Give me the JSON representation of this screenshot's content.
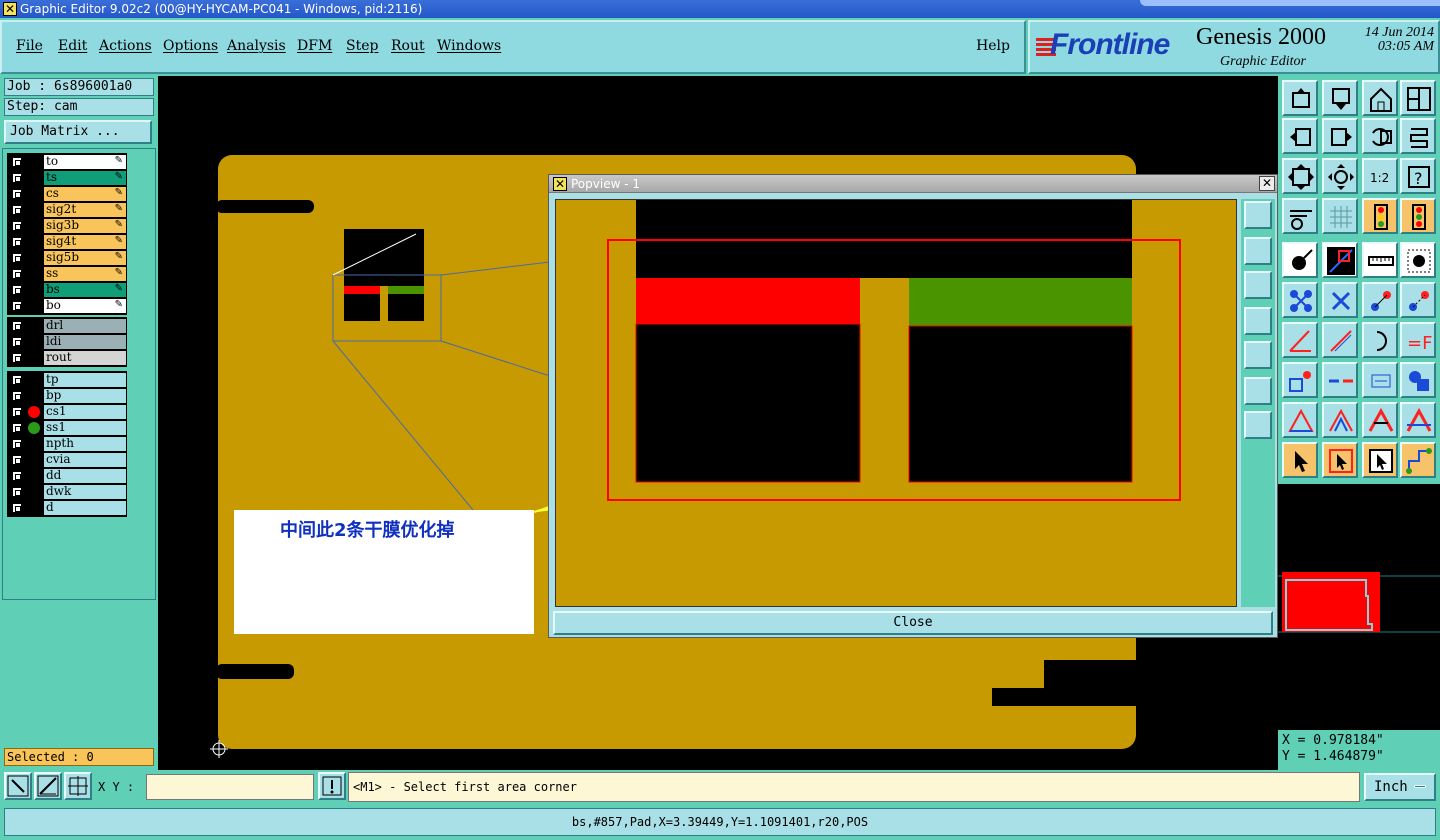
{
  "window": {
    "title": "Graphic Editor 9.02c2 (00@HY-HYCAM-PC041 - Windows, pid:2116)"
  },
  "menu": {
    "items": [
      "File",
      "Edit",
      "Actions",
      "Options",
      "Analysis",
      "DFM",
      "Step",
      "Rout",
      "Windows"
    ],
    "help": "Help"
  },
  "logo": {
    "brand": "Frontline",
    "product": "Genesis 2000",
    "subtitle": "Graphic Editor",
    "date": "14 Jun 2014",
    "time": "03:05 AM"
  },
  "job": {
    "job_label": "Job : 6s896001a0",
    "step_label": "Step: cam",
    "matrix_button": "Job Matrix ..."
  },
  "layers": {
    "group1": [
      {
        "name": "to",
        "color": "#ffffff"
      },
      {
        "name": "ts",
        "color": "#0f9e78"
      },
      {
        "name": "cs",
        "color": "#f9c45a"
      },
      {
        "name": "sig2t",
        "color": "#f9c45a"
      },
      {
        "name": "sig3b",
        "color": "#f9c45a"
      },
      {
        "name": "sig4t",
        "color": "#f9c45a"
      },
      {
        "name": "sig5b",
        "color": "#f9c45a"
      },
      {
        "name": "ss",
        "color": "#f9c45a"
      },
      {
        "name": "bs",
        "color": "#0f9e78"
      },
      {
        "name": "bo",
        "color": "#ffffff"
      }
    ],
    "group2": [
      {
        "name": "drl",
        "color": "#9ab0b4"
      },
      {
        "name": "ldi",
        "color": "#9ab0b4"
      },
      {
        "name": "rout",
        "color": "#d4d4d4"
      }
    ],
    "group3": [
      {
        "name": "tp",
        "color": "#a9dfe6"
      },
      {
        "name": "bp",
        "color": "#a9dfe6"
      },
      {
        "name": "cs1",
        "color": "#a9dfe6",
        "dot": "#ff0000"
      },
      {
        "name": "ss1",
        "color": "#a9dfe6",
        "dot": "#2a9a1a"
      },
      {
        "name": "npth",
        "color": "#a9dfe6"
      },
      {
        "name": "cvia",
        "color": "#a9dfe6"
      },
      {
        "name": "dd",
        "color": "#a9dfe6"
      },
      {
        "name": "dwk",
        "color": "#a9dfe6"
      },
      {
        "name": "d",
        "color": "#a9dfe6"
      }
    ]
  },
  "selected": "Selected : 0",
  "popview": {
    "title": "Popview - 1",
    "close_label": "Close"
  },
  "annotation": {
    "text": "中间此2条干膜优化掉"
  },
  "coords": {
    "x": "X = 0.978184\"",
    "y": "Y = 1.464879\""
  },
  "bottom": {
    "xy_label": "X Y :",
    "xy_value": "",
    "prompt": "<M1> - Select first area corner",
    "units": "Inch"
  },
  "status": {
    "text": "bs,#857,Pad,X=3.39449,Y=1.1091401,r20,POS"
  },
  "colors": {
    "board": "#c69a00",
    "feature_red": "#ff0000",
    "feature_green": "#4a9400",
    "panel": "#5fcfb5",
    "button": "#a9dfe6",
    "highlight_orange": "#f9c45a"
  }
}
